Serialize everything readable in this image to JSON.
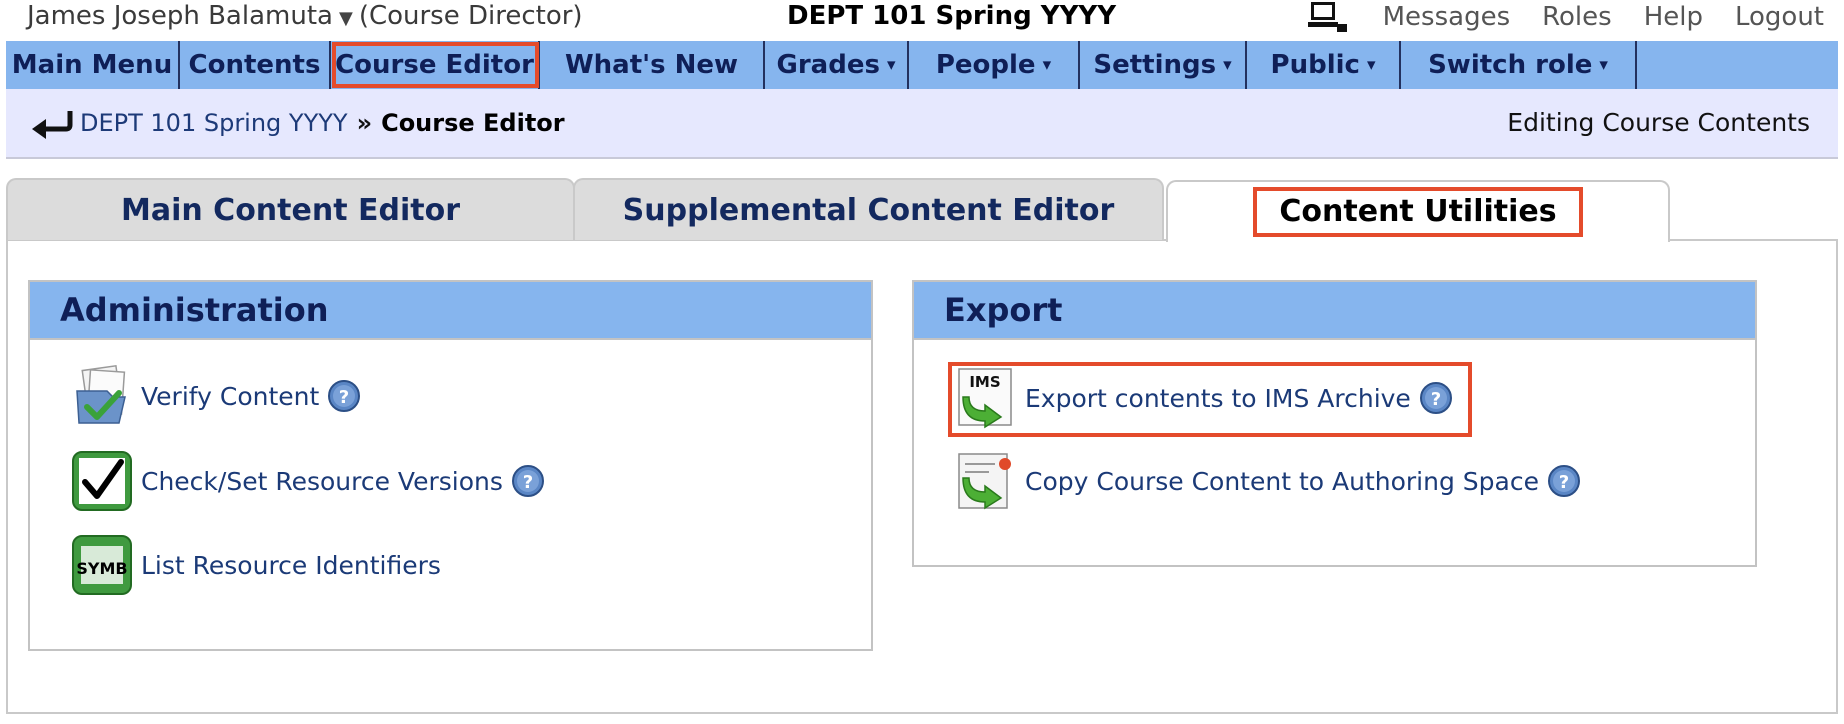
{
  "topbar": {
    "user_name": "James Joseph Balamuta",
    "user_caret": "▼",
    "role": "(Course Director)",
    "course_title": "DEPT 101 Spring YYYY",
    "links": [
      "Messages",
      "Roles",
      "Help",
      "Logout"
    ]
  },
  "nav": {
    "items": [
      "Main Menu",
      "Contents",
      "Course Editor",
      "What's New",
      "Grades",
      "People",
      "Settings",
      "Public",
      "Switch role"
    ],
    "dropdown_glyph": "▾",
    "highlighted": "Course Editor"
  },
  "breadcrumb": {
    "course": "DEPT 101 Spring YYYY",
    "separator": "»",
    "current": "Course Editor",
    "page_status": "Editing Course Contents"
  },
  "tabs": {
    "main": "Main Content Editor",
    "supplemental": "Supplemental Content Editor",
    "utilities": "Content Utilities",
    "active": "Content Utilities"
  },
  "administration": {
    "title": "Administration",
    "items": [
      "Verify Content",
      "Check/Set Resource Versions",
      "List Resource Identifiers"
    ],
    "symb_icon_text": "SYMB"
  },
  "export": {
    "title": "Export",
    "items": [
      "Export contents to IMS Archive",
      "Copy Course Content to Authoring Space"
    ],
    "ims_icon_text": "IMS"
  },
  "colors": {
    "nav_bg": "#86b5ee",
    "nav_text": "#0f1f57",
    "breadcrumb_bg": "#e6e8fe",
    "highlight": "#e44b2b",
    "link": "#1b3a77"
  },
  "icons": [
    "computer-icon",
    "back-arrow-icon",
    "verify-content-icon",
    "checkmark-icon",
    "symb-icon",
    "ims-export-icon",
    "copy-content-icon",
    "help-icon"
  ]
}
